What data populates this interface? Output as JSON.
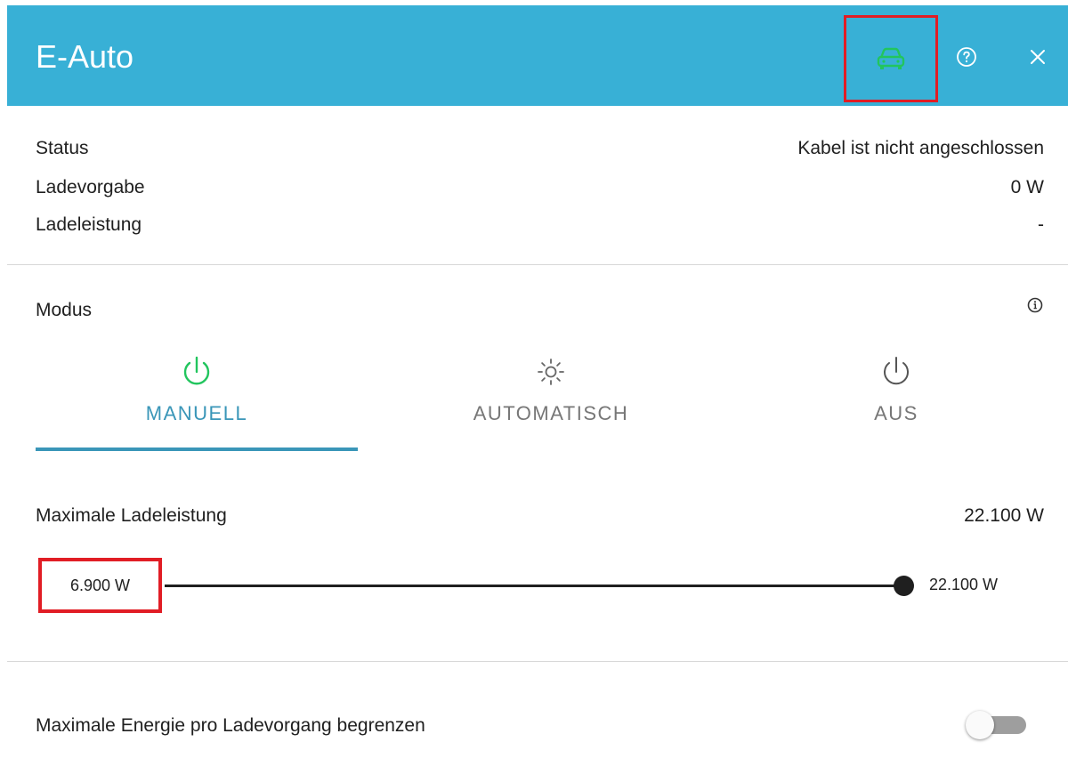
{
  "header": {
    "title": "E-Auto",
    "car_icon": "car-icon",
    "help_icon": "help-circle-icon",
    "close_icon": "close-icon",
    "car_icon_color": "#22c55e",
    "background_color": "#38b0d6"
  },
  "status": {
    "rows": [
      {
        "label": "Status",
        "value": "Kabel ist nicht angeschlossen"
      },
      {
        "label": "Ladevorgabe",
        "value": "0 W"
      },
      {
        "label": "Ladeleistung",
        "value": "-"
      }
    ]
  },
  "mode": {
    "label": "Modus",
    "info_icon": "info-icon",
    "tabs": [
      {
        "label": "MANUELL",
        "icon": "power-icon",
        "active": true,
        "color": "#22c55e"
      },
      {
        "label": "AUTOMATISCH",
        "icon": "sun-icon",
        "active": false
      },
      {
        "label": "AUS",
        "icon": "power-icon",
        "active": false
      }
    ],
    "accent_color": "#3a96b8"
  },
  "max_power": {
    "label": "Maximale Ladeleistung",
    "value": "22.100 W",
    "slider": {
      "min_label": "6.900 W",
      "max_label": "22.100 W",
      "value_fraction": 1.0
    }
  },
  "energy_limit": {
    "label": "Maximale Energie pro Ladevorgang begrenzen",
    "enabled": false
  }
}
